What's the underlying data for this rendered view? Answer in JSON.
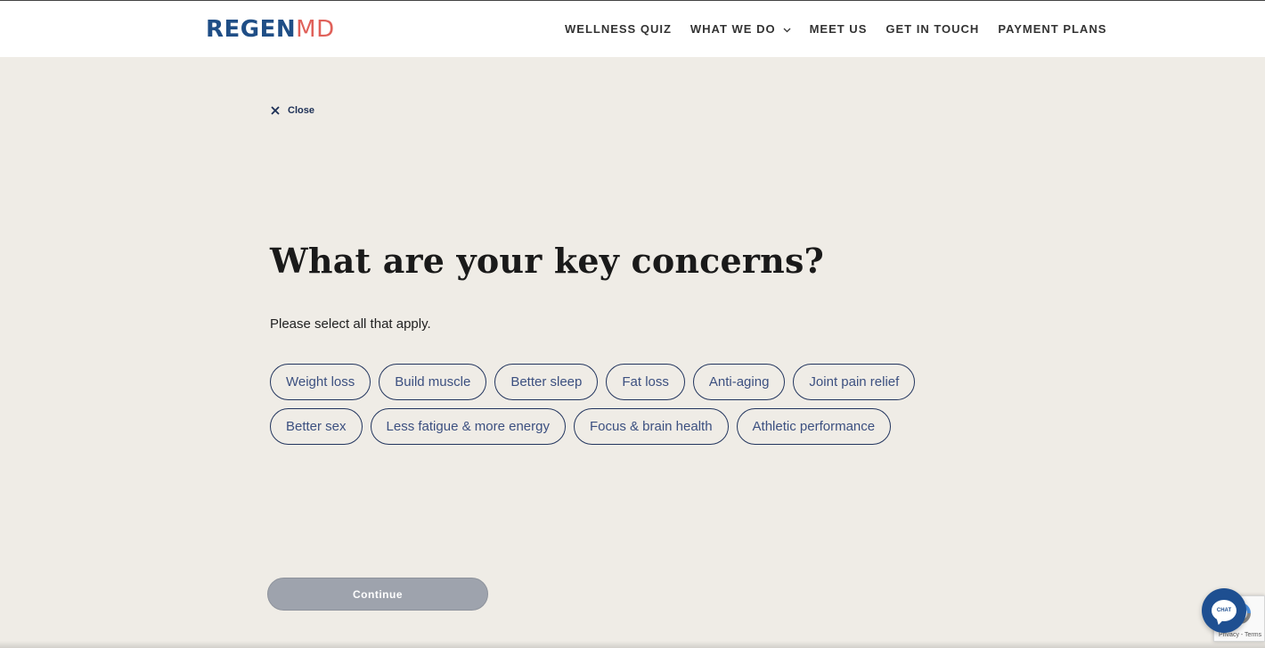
{
  "header": {
    "logo_primary": "REGEN",
    "logo_secondary": "MD",
    "nav": [
      {
        "label": "WELLNESS QUIZ"
      },
      {
        "label": "WHAT WE DO"
      },
      {
        "label": "MEET US"
      },
      {
        "label": "GET IN TOUCH"
      },
      {
        "label": "PAYMENT PLANS"
      }
    ]
  },
  "quiz": {
    "close_label": "Close",
    "question": "What are your key concerns?",
    "instruction": "Please select all that apply.",
    "options": [
      "Weight loss",
      "Build muscle",
      "Better sleep",
      "Fat loss",
      "Anti-aging",
      "Joint pain relief",
      "Better sex",
      "Less fatigue & more energy",
      "Focus & brain health",
      "Athletic performance"
    ],
    "continue_label": "Continue"
  },
  "widgets": {
    "chat_label": "CHAT",
    "recaptcha_text": "Privacy - Terms"
  },
  "colors": {
    "background": "#efece6",
    "brand_blue": "#1f4e86",
    "brand_coral": "#e0615a",
    "pill_border": "#22355e",
    "continue_disabled": "#9ea3ad"
  }
}
